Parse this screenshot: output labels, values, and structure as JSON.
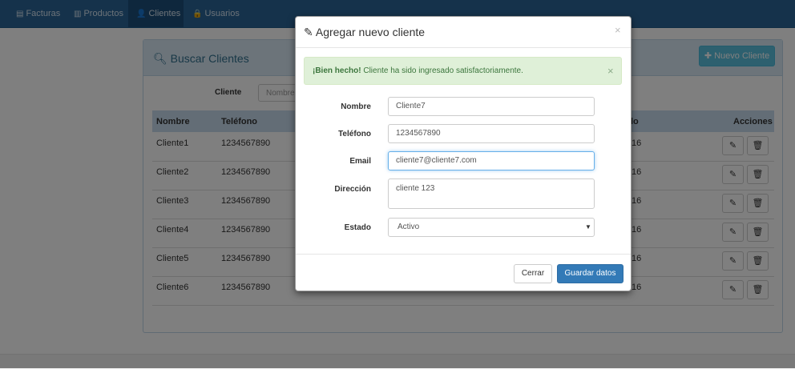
{
  "navbar": {
    "items": [
      {
        "icon": "list-icon",
        "glyph": "▤",
        "label": "Facturas"
      },
      {
        "icon": "book-icon",
        "glyph": "▥",
        "label": "Productos"
      },
      {
        "icon": "user-icon",
        "glyph": "👤",
        "label": "Clientes",
        "active": true
      },
      {
        "icon": "lock-icon",
        "glyph": "🔒",
        "label": "Usuarios"
      }
    ]
  },
  "panel": {
    "title": "Buscar Clientes",
    "new_button": "Nuevo Cliente",
    "search": {
      "label": "Cliente",
      "placeholder": "Nombre"
    }
  },
  "table": {
    "headers": [
      "Nombre",
      "Teléfono",
      "lo",
      "Acciones"
    ],
    "rows": [
      {
        "nombre": "Cliente1",
        "telefono": "1234567890",
        "col": "16"
      },
      {
        "nombre": "Cliente2",
        "telefono": "1234567890",
        "col": "16"
      },
      {
        "nombre": "Cliente3",
        "telefono": "1234567890",
        "col": "16"
      },
      {
        "nombre": "Cliente4",
        "telefono": "1234567890",
        "col": "16"
      },
      {
        "nombre": "Cliente5",
        "telefono": "1234567890",
        "col": "16"
      },
      {
        "nombre": "Cliente6",
        "telefono": "1234567890",
        "col": "16"
      }
    ]
  },
  "modal": {
    "title": "Agregar nuevo cliente",
    "close": "×",
    "alert": {
      "strong": "¡Bien hecho!",
      "text": " Cliente ha sido ingresado satisfactoriamente.",
      "close": "×"
    },
    "fields": {
      "nombre": {
        "label": "Nombre",
        "value": "Cliente7"
      },
      "telefono": {
        "label": "Teléfono",
        "value": "1234567890"
      },
      "email": {
        "label": "Email",
        "value": "cliente7@cliente7.com"
      },
      "direccion": {
        "label": "Dirección",
        "value": "cliente 123"
      },
      "estado": {
        "label": "Estado",
        "value": "Activo"
      }
    },
    "buttons": {
      "cerrar": "Cerrar",
      "guardar": "Guardar datos"
    }
  }
}
